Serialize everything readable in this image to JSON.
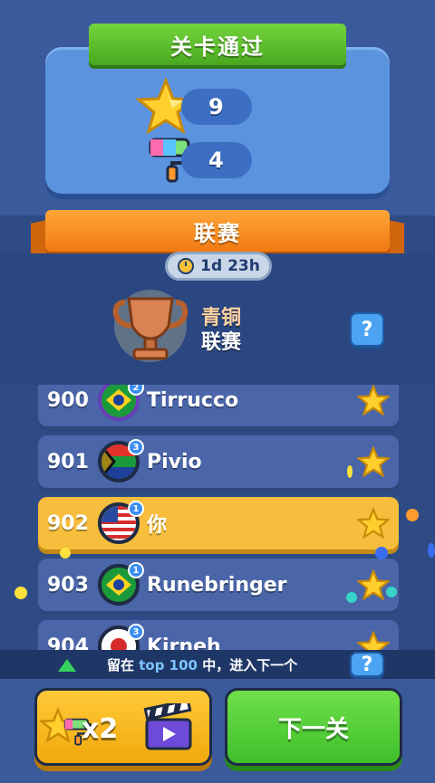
{
  "level_complete": {
    "title": "关卡通过",
    "stars_reward": "9",
    "roller_reward": "4"
  },
  "league": {
    "title": "联赛",
    "timer": "1d 23h",
    "name_line1": "青铜",
    "name_line2": "联赛",
    "help_label": "?"
  },
  "leaderboard": [
    {
      "rank": "900",
      "name": "Tirrucco",
      "level": "2",
      "flag": "brazil"
    },
    {
      "rank": "901",
      "name": "Pivio",
      "level": "3",
      "flag": "south-africa"
    },
    {
      "rank": "902",
      "name": "你",
      "level": "1",
      "flag": "usa",
      "is_me": true
    },
    {
      "rank": "903",
      "name": "Runebringer",
      "level": "1",
      "flag": "brazil"
    },
    {
      "rank": "904",
      "name": "Kirneh",
      "level": "3",
      "flag": "japan"
    }
  ],
  "tip": {
    "prefix": "留在 ",
    "highlight": "top 100",
    "suffix": " 中，进入下一个",
    "help_label": "?"
  },
  "buttons": {
    "multiplier_label": "x2",
    "next_label": "下一关"
  },
  "colors": {
    "green_ribbon": "#49a81f",
    "orange_ribbon": "#f07a10",
    "highlight_row": "#f6be3c",
    "row": "#4a66a8"
  },
  "icons": {
    "star": "star-icon",
    "roller": "paint-roller-icon",
    "trophy": "trophy-icon",
    "clock": "clock-icon",
    "video": "clapperboard-icon"
  }
}
